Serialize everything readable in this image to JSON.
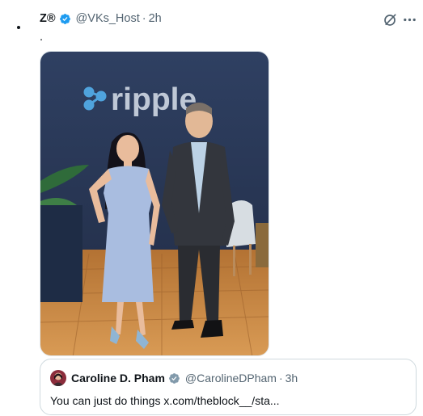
{
  "tweet": {
    "display_name": "Z®",
    "handle": "@VKs_Host",
    "separator": "·",
    "time": "2h",
    "text": ".",
    "icons": {
      "verified": "verified-badge-icon",
      "grok": "grok-icon",
      "more": "more-options-icon"
    }
  },
  "media": {
    "logo_text": "ripple",
    "colors": {
      "wall": "#2d3d5c",
      "floor": "#c98a44",
      "dress": "#a9bde0",
      "suit": "#33363d"
    }
  },
  "quote": {
    "display_name": "Caroline D. Pham",
    "handle": "@CarolineDPham",
    "separator": "·",
    "time": "3h",
    "text": "You can just do things x.com/theblock__/sta..."
  },
  "colors": {
    "accent": "#1d9bf0",
    "secondary_text": "#536471",
    "border": "#cfd9de"
  }
}
